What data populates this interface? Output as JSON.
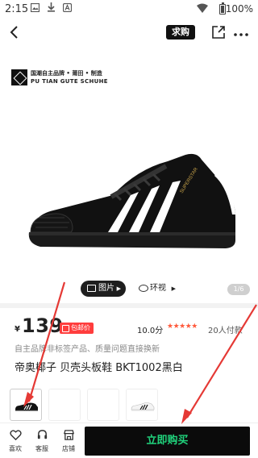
{
  "status_bar": {
    "time": "2:15",
    "icons": [
      "photo-icon",
      "download-icon",
      "text-icon",
      "wifi-icon",
      "battery-icon"
    ],
    "battery": "100%"
  },
  "top_bar": {
    "buy_tag": "求购",
    "icons": [
      "back-icon",
      "share-icon",
      "more-icon"
    ]
  },
  "brand": {
    "line1": "国潮自主品牌 • 莆田 • 制造",
    "line2": "PU TIAN GUTE SCHUHE"
  },
  "media_tabs": {
    "photos": "图片",
    "view_360": "环视",
    "counter": "1/6"
  },
  "product": {
    "currency": "¥",
    "price": "139",
    "badge": "包邮价",
    "score": "10.0分",
    "stars": "★★★★★",
    "paid_count": "20人付款",
    "guarantee": "自主品牌非标签产品、质量问题直接换新",
    "title": "帝奥椰子 贝壳头板鞋 BKT1002黑白"
  },
  "variants": [
    {
      "color": "black"
    },
    {
      "color": "blank"
    },
    {
      "color": "blank"
    },
    {
      "color": "white"
    }
  ],
  "bottom_bar": {
    "favorite": "喜欢",
    "service": "客服",
    "store": "店铺",
    "buy_now": "立即购买"
  },
  "colors": {
    "accent_green": "#20d37c",
    "badge_red": "#ff3d3d",
    "star_orange": "#ff5a3c",
    "annotation_red": "#e53935"
  }
}
